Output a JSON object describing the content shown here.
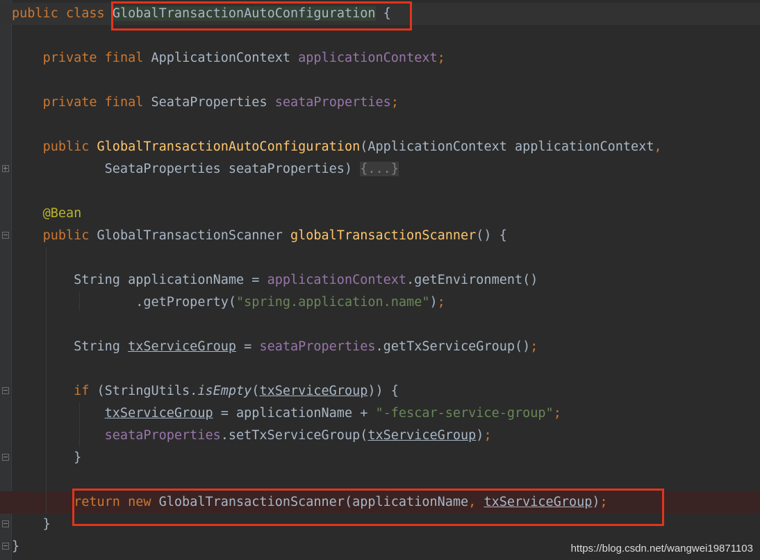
{
  "editor": {
    "class_decl": {
      "public": "public",
      "class": "class",
      "name": "GlobalTransactionAutoConfiguration",
      "brace": " {"
    },
    "field1": {
      "private": "private",
      "final": "final",
      "type": "ApplicationContext",
      "name": "applicationContext",
      "semi": ";"
    },
    "field2": {
      "private": "private",
      "final": "final",
      "type": "SeataProperties",
      "name": "seataProperties",
      "semi": ";"
    },
    "ctor_line1": {
      "public": "public",
      "name": "GlobalTransactionAutoConfiguration",
      "params": "(ApplicationContext applicationContext",
      "comma": ","
    },
    "ctor_line2": {
      "params": "SeataProperties seataProperties) ",
      "folded": "{...}"
    },
    "annotation": "@Bean",
    "method_decl": {
      "public": "public",
      "type": "GlobalTransactionScanner",
      "name": "globalTransactionScanner",
      "rest": "() {"
    },
    "line_app_name1": {
      "type": "String applicationName = ",
      "field": "applicationContext",
      "call": ".getEnvironment()"
    },
    "line_app_name2": {
      "call": ".getProperty(",
      "str": "\"spring.application.name\"",
      "end": ")",
      "semi": ";"
    },
    "line_tx_group": {
      "type": "String ",
      "var": "txServiceGroup",
      "eq": " = ",
      "field": "seataProperties",
      "call": ".getTxServiceGroup()",
      "semi": ";"
    },
    "if_line": {
      "if": "if",
      "open": " (StringUtils.",
      "method": "isEmpty",
      "paren": "(",
      "var": "txServiceGroup",
      "close": ")) {"
    },
    "assign_line": {
      "var": "txServiceGroup",
      "mid": " = applicationName + ",
      "str": "\"-fescar-service-group\"",
      "semi": ";"
    },
    "setter_line": {
      "field": "seataProperties",
      "call": ".setTxServiceGroup(",
      "var": "txServiceGroup",
      "close": ")",
      "semi": ";"
    },
    "if_close": "}",
    "return_line": {
      "return": "return",
      "new": "new",
      "ctor": "GlobalTransactionScanner(applicationName",
      "comma": ",",
      "var": "txServiceGroup",
      "close": ")",
      "semi": ";"
    },
    "method_close": "}",
    "class_close": "}"
  },
  "watermark": "https://blog.csdn.net/wangwei19871103",
  "colors": {
    "keyword": "#cc7832",
    "field": "#9876aa",
    "method": "#ffc66d",
    "string": "#6a8759",
    "annotation": "#bbb529",
    "text": "#a9b7c6",
    "highlight_box": "#e3341b"
  }
}
